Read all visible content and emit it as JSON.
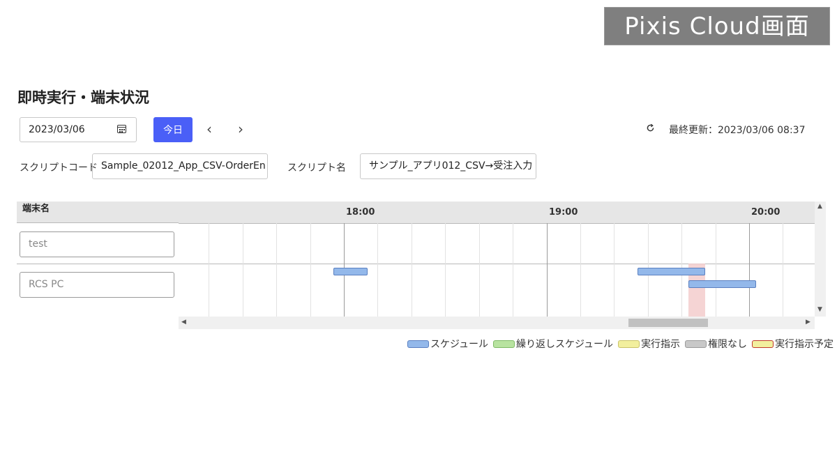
{
  "badge": "Pixis Cloud画面",
  "page_title": "即時実行・端末状況",
  "toolbar": {
    "date_value": "2023/03/06",
    "today_label": "今日",
    "prev_label": "‹",
    "next_label": "›",
    "last_updated": "最終更新：2023/03/06 08:37"
  },
  "filters": {
    "script_code_label": "スクリプトコード",
    "script_code_value": "Sample_02012_App_CSV-OrderEn",
    "script_name_label": "スクリプト名",
    "script_name_value": "サンプル_アプリ012_CSV→受注入力"
  },
  "grid": {
    "terminal_header": "端末名",
    "hours": [
      "18:00",
      "19:00",
      "20:00"
    ],
    "rows": [
      {
        "name": "test",
        "bars": []
      },
      {
        "name": "RCS PC",
        "bars": [
          {
            "start": "17:57",
            "end": "18:07",
            "type": "schedule"
          },
          {
            "start": "19:27",
            "end": "19:47",
            "type": "schedule"
          },
          {
            "start": "19:42",
            "end": "20:02",
            "type": "schedule"
          }
        ]
      }
    ],
    "highlight": {
      "start": "19:42",
      "end": "19:47"
    }
  },
  "legend": [
    {
      "label": "スケジュール",
      "fill": "#93b8ea",
      "border": "#5a7fc0"
    },
    {
      "label": "繰り返しスケジュール",
      "fill": "#b8e3a0",
      "border": "#7fba66"
    },
    {
      "label": "実行指示",
      "fill": "#f2ef9e",
      "border": "#c9c26a"
    },
    {
      "label": "権限なし",
      "fill": "#c8c8c8",
      "border": "#9a9a9a"
    },
    {
      "label": "実行指示予定",
      "fill": "#f2ef9e",
      "border": "#c0392b"
    }
  ],
  "colors": {
    "accent": "#4a5ff7",
    "highlight": "#f2c9c9"
  }
}
